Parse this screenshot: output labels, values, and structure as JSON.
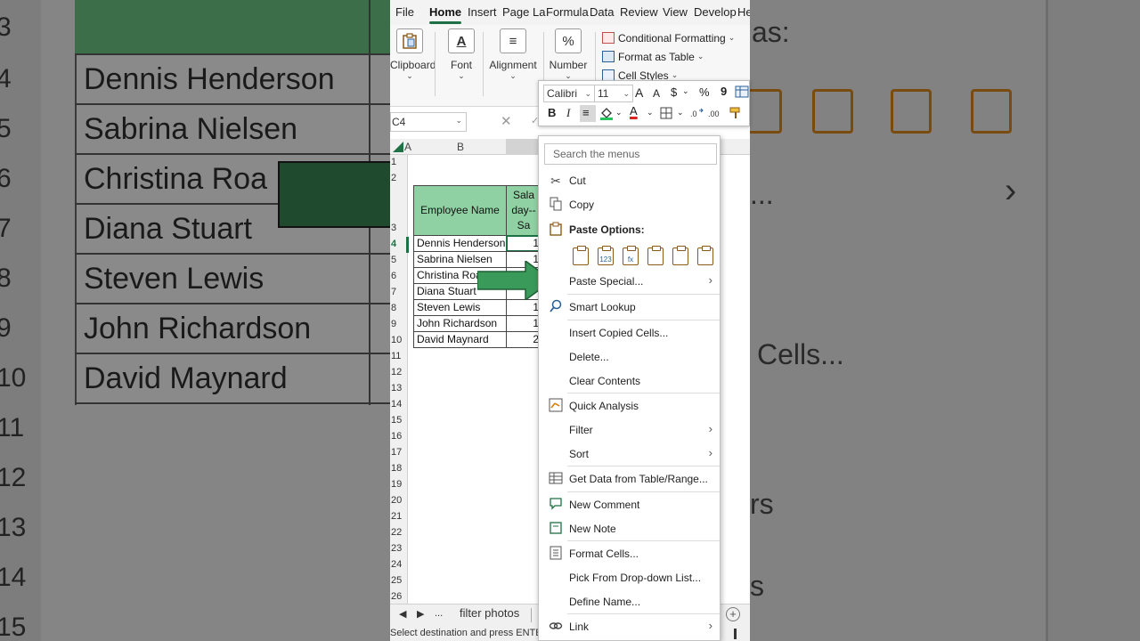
{
  "bg": {
    "row_numbers": [
      "3",
      "4",
      "5",
      "6",
      "7",
      "8",
      "9",
      "10",
      "11",
      "12",
      "13",
      "14",
      "15"
    ],
    "names": [
      "Dennis Henderson",
      "Sabrina Nielsen",
      "Christina Roa",
      "Diana Stuart",
      "Steven Lewis",
      "John Richardson",
      "David Maynard"
    ],
    "right_text_top": "as:",
    "right_text_cells": "Cells...",
    "right_text_dots": "...",
    "right_text_rs": "rs",
    "right_text_p": "s",
    "right_chevron": "›"
  },
  "ribbon": {
    "tabs": [
      "File",
      "Home",
      "Insert",
      "Page La",
      "Formula",
      "Data",
      "Review",
      "View",
      "Develop",
      "He"
    ],
    "groups": {
      "clipboard": "Clipboard",
      "font": "Font",
      "alignment": "Alignment",
      "number": "Number",
      "number_symbol": "%",
      "font_symbol": "A",
      "alignment_symbol": "≡"
    },
    "styles": {
      "conditional_formatting": "Conditional Formatting",
      "format_as_table": "Format as Table",
      "cell_styles": "Cell Styles"
    }
  },
  "formula_bar": {
    "name_box": "C4",
    "cancel_symbol": "✕",
    "enter_symbol": "✓"
  },
  "grid": {
    "columns": [
      "A",
      "B"
    ],
    "rows": [
      "1",
      "2",
      "3",
      "4",
      "5",
      "6",
      "7",
      "8",
      "9",
      "10",
      "11",
      "12",
      "13",
      "14",
      "15",
      "16",
      "17",
      "18",
      "19",
      "20",
      "21",
      "22",
      "23",
      "24",
      "25",
      "26"
    ]
  },
  "table": {
    "header_name": "Employee Name",
    "header_salary_lines": [
      "Sala",
      "day--",
      "Sa"
    ],
    "rows": [
      {
        "name": "Dennis Henderson",
        "value": "1"
      },
      {
        "name": "Sabrina Nielsen",
        "value": "1"
      },
      {
        "name": "Christina Roa",
        "value": ""
      },
      {
        "name": "Diana Stuart",
        "value": ""
      },
      {
        "name": "Steven Lewis",
        "value": "1"
      },
      {
        "name": "John Richardson",
        "value": "1"
      },
      {
        "name": "David Maynard",
        "value": "2"
      }
    ]
  },
  "mini_toolbar": {
    "font": "Calibri",
    "size": "11",
    "grow": "A",
    "shrink": "A",
    "currency": "$",
    "percent": "%",
    "comma": "9",
    "bold": "B",
    "italic": "I",
    "align": "≡",
    "font_color": "A"
  },
  "context_menu": {
    "search_placeholder": "Search the menus",
    "items": {
      "cut": "Cut",
      "copy": "Copy",
      "paste_options": "Paste Options:",
      "paste_special": "Paste Special...",
      "smart_lookup": "Smart Lookup",
      "insert_copied": "Insert Copied Cells...",
      "delete": "Delete...",
      "clear_contents": "Clear Contents",
      "quick_analysis": "Quick Analysis",
      "filter": "Filter",
      "sort": "Sort",
      "get_data": "Get Data from Table/Range...",
      "new_comment": "New Comment",
      "new_note": "New Note",
      "format_cells": "Format Cells...",
      "pick_dropdown": "Pick From Drop-down List...",
      "define_name": "Define Name...",
      "link": "Link"
    },
    "paste_icon_marks": [
      "",
      "123",
      "fx",
      "",
      "",
      ""
    ]
  },
  "sheet_tabs": {
    "prev": "◀",
    "next": "▶",
    "more": "...",
    "active": "filter photos",
    "add": "+"
  },
  "status_bar": {
    "message": "Select destination and press ENTER or c"
  },
  "colors": {
    "excel_green": "#1e7145",
    "header_fill": "#8fd1a3",
    "arrow_green": "#3a9a5a"
  }
}
